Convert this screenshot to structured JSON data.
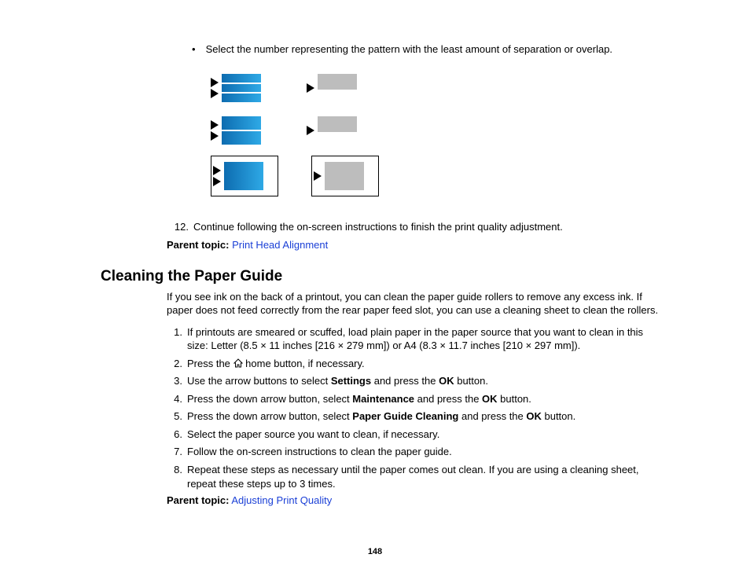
{
  "top": {
    "bullet": "Select the number representing the pattern with the least amount of separation or overlap.",
    "step12_num": "12.",
    "step12": "Continue following the on-screen instructions to finish the print quality adjustment.",
    "parent_topic_label": "Parent topic:",
    "parent_topic_link": "Print Head Alignment"
  },
  "section": {
    "heading": "Cleaning the Paper Guide",
    "intro": "If you see ink on the back of a printout, you can clean the paper guide rollers to remove any excess ink. If paper does not feed correctly from the rear paper feed slot, you can use a cleaning sheet to clean the rollers.",
    "steps": [
      {
        "n": "1.",
        "text": "If printouts are smeared or scuffed, load plain paper in the paper source that you want to clean in this size: Letter (8.5 × 11 inches [216 × 279 mm]) or A4 (8.3 × 11.7 inches [210 × 297 mm])."
      },
      {
        "n": "2.",
        "pre": "Press the ",
        "post": " home button, if necessary."
      },
      {
        "n": "3.",
        "pre": "Use the arrow buttons to select ",
        "b1": "Settings",
        "mid": " and press the ",
        "b2": "OK",
        "post": " button."
      },
      {
        "n": "4.",
        "pre": "Press the down arrow button, select ",
        "b1": "Maintenance",
        "mid": " and press the ",
        "b2": "OK",
        "post": " button."
      },
      {
        "n": "5.",
        "pre": "Press the down arrow button, select ",
        "b1": "Paper Guide Cleaning",
        "mid": " and press the ",
        "b2": "OK",
        "post": " button."
      },
      {
        "n": "6.",
        "text": "Select the paper source you want to clean, if necessary."
      },
      {
        "n": "7.",
        "text": "Follow the on-screen instructions to clean the paper guide."
      },
      {
        "n": "8.",
        "text": "Repeat these steps as necessary until the paper comes out clean. If you are using a cleaning sheet, repeat these steps up to 3 times."
      }
    ],
    "parent_topic_label": "Parent topic:",
    "parent_topic_link": "Adjusting Print Quality"
  },
  "page_number": "148"
}
